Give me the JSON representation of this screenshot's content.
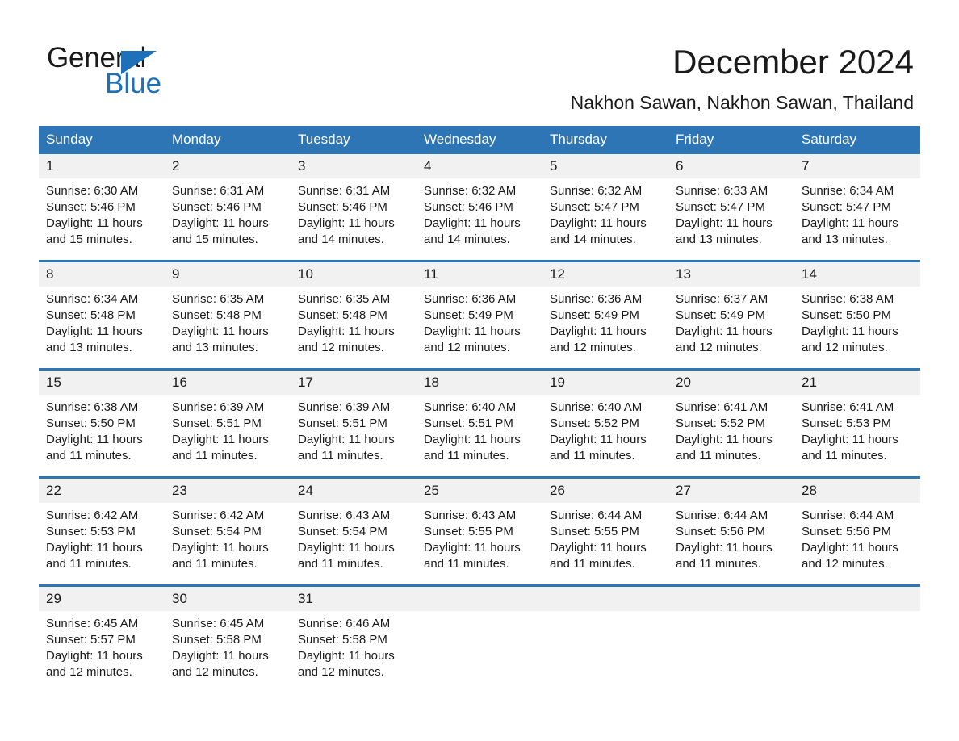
{
  "brand": {
    "name_part1": "General",
    "name_part2": "Blue",
    "accent_color": "#1e70b8",
    "triangle_icon": "triangle-icon"
  },
  "header": {
    "title": "December 2024",
    "subtitle": "Nakhon Sawan, Nakhon Sawan, Thailand"
  },
  "calendar": {
    "header_bg": "#2e75b6",
    "daynum_bg": "#f1f1f1",
    "weekday_headers": [
      "Sunday",
      "Monday",
      "Tuesday",
      "Wednesday",
      "Thursday",
      "Friday",
      "Saturday"
    ],
    "weeks": [
      [
        {
          "day": "1",
          "sunrise": "Sunrise: 6:30 AM",
          "sunset": "Sunset: 5:46 PM",
          "daylight": "Daylight: 11 hours and 15 minutes."
        },
        {
          "day": "2",
          "sunrise": "Sunrise: 6:31 AM",
          "sunset": "Sunset: 5:46 PM",
          "daylight": "Daylight: 11 hours and 15 minutes."
        },
        {
          "day": "3",
          "sunrise": "Sunrise: 6:31 AM",
          "sunset": "Sunset: 5:46 PM",
          "daylight": "Daylight: 11 hours and 14 minutes."
        },
        {
          "day": "4",
          "sunrise": "Sunrise: 6:32 AM",
          "sunset": "Sunset: 5:46 PM",
          "daylight": "Daylight: 11 hours and 14 minutes."
        },
        {
          "day": "5",
          "sunrise": "Sunrise: 6:32 AM",
          "sunset": "Sunset: 5:47 PM",
          "daylight": "Daylight: 11 hours and 14 minutes."
        },
        {
          "day": "6",
          "sunrise": "Sunrise: 6:33 AM",
          "sunset": "Sunset: 5:47 PM",
          "daylight": "Daylight: 11 hours and 13 minutes."
        },
        {
          "day": "7",
          "sunrise": "Sunrise: 6:34 AM",
          "sunset": "Sunset: 5:47 PM",
          "daylight": "Daylight: 11 hours and 13 minutes."
        }
      ],
      [
        {
          "day": "8",
          "sunrise": "Sunrise: 6:34 AM",
          "sunset": "Sunset: 5:48 PM",
          "daylight": "Daylight: 11 hours and 13 minutes."
        },
        {
          "day": "9",
          "sunrise": "Sunrise: 6:35 AM",
          "sunset": "Sunset: 5:48 PM",
          "daylight": "Daylight: 11 hours and 13 minutes."
        },
        {
          "day": "10",
          "sunrise": "Sunrise: 6:35 AM",
          "sunset": "Sunset: 5:48 PM",
          "daylight": "Daylight: 11 hours and 12 minutes."
        },
        {
          "day": "11",
          "sunrise": "Sunrise: 6:36 AM",
          "sunset": "Sunset: 5:49 PM",
          "daylight": "Daylight: 11 hours and 12 minutes."
        },
        {
          "day": "12",
          "sunrise": "Sunrise: 6:36 AM",
          "sunset": "Sunset: 5:49 PM",
          "daylight": "Daylight: 11 hours and 12 minutes."
        },
        {
          "day": "13",
          "sunrise": "Sunrise: 6:37 AM",
          "sunset": "Sunset: 5:49 PM",
          "daylight": "Daylight: 11 hours and 12 minutes."
        },
        {
          "day": "14",
          "sunrise": "Sunrise: 6:38 AM",
          "sunset": "Sunset: 5:50 PM",
          "daylight": "Daylight: 11 hours and 12 minutes."
        }
      ],
      [
        {
          "day": "15",
          "sunrise": "Sunrise: 6:38 AM",
          "sunset": "Sunset: 5:50 PM",
          "daylight": "Daylight: 11 hours and 11 minutes."
        },
        {
          "day": "16",
          "sunrise": "Sunrise: 6:39 AM",
          "sunset": "Sunset: 5:51 PM",
          "daylight": "Daylight: 11 hours and 11 minutes."
        },
        {
          "day": "17",
          "sunrise": "Sunrise: 6:39 AM",
          "sunset": "Sunset: 5:51 PM",
          "daylight": "Daylight: 11 hours and 11 minutes."
        },
        {
          "day": "18",
          "sunrise": "Sunrise: 6:40 AM",
          "sunset": "Sunset: 5:51 PM",
          "daylight": "Daylight: 11 hours and 11 minutes."
        },
        {
          "day": "19",
          "sunrise": "Sunrise: 6:40 AM",
          "sunset": "Sunset: 5:52 PM",
          "daylight": "Daylight: 11 hours and 11 minutes."
        },
        {
          "day": "20",
          "sunrise": "Sunrise: 6:41 AM",
          "sunset": "Sunset: 5:52 PM",
          "daylight": "Daylight: 11 hours and 11 minutes."
        },
        {
          "day": "21",
          "sunrise": "Sunrise: 6:41 AM",
          "sunset": "Sunset: 5:53 PM",
          "daylight": "Daylight: 11 hours and 11 minutes."
        }
      ],
      [
        {
          "day": "22",
          "sunrise": "Sunrise: 6:42 AM",
          "sunset": "Sunset: 5:53 PM",
          "daylight": "Daylight: 11 hours and 11 minutes."
        },
        {
          "day": "23",
          "sunrise": "Sunrise: 6:42 AM",
          "sunset": "Sunset: 5:54 PM",
          "daylight": "Daylight: 11 hours and 11 minutes."
        },
        {
          "day": "24",
          "sunrise": "Sunrise: 6:43 AM",
          "sunset": "Sunset: 5:54 PM",
          "daylight": "Daylight: 11 hours and 11 minutes."
        },
        {
          "day": "25",
          "sunrise": "Sunrise: 6:43 AM",
          "sunset": "Sunset: 5:55 PM",
          "daylight": "Daylight: 11 hours and 11 minutes."
        },
        {
          "day": "26",
          "sunrise": "Sunrise: 6:44 AM",
          "sunset": "Sunset: 5:55 PM",
          "daylight": "Daylight: 11 hours and 11 minutes."
        },
        {
          "day": "27",
          "sunrise": "Sunrise: 6:44 AM",
          "sunset": "Sunset: 5:56 PM",
          "daylight": "Daylight: 11 hours and 11 minutes."
        },
        {
          "day": "28",
          "sunrise": "Sunrise: 6:44 AM",
          "sunset": "Sunset: 5:56 PM",
          "daylight": "Daylight: 11 hours and 12 minutes."
        }
      ],
      [
        {
          "day": "29",
          "sunrise": "Sunrise: 6:45 AM",
          "sunset": "Sunset: 5:57 PM",
          "daylight": "Daylight: 11 hours and 12 minutes."
        },
        {
          "day": "30",
          "sunrise": "Sunrise: 6:45 AM",
          "sunset": "Sunset: 5:58 PM",
          "daylight": "Daylight: 11 hours and 12 minutes."
        },
        {
          "day": "31",
          "sunrise": "Sunrise: 6:46 AM",
          "sunset": "Sunset: 5:58 PM",
          "daylight": "Daylight: 11 hours and 12 minutes."
        },
        {
          "day": "",
          "sunrise": "",
          "sunset": "",
          "daylight": ""
        },
        {
          "day": "",
          "sunrise": "",
          "sunset": "",
          "daylight": ""
        },
        {
          "day": "",
          "sunrise": "",
          "sunset": "",
          "daylight": ""
        },
        {
          "day": "",
          "sunrise": "",
          "sunset": "",
          "daylight": ""
        }
      ]
    ]
  }
}
